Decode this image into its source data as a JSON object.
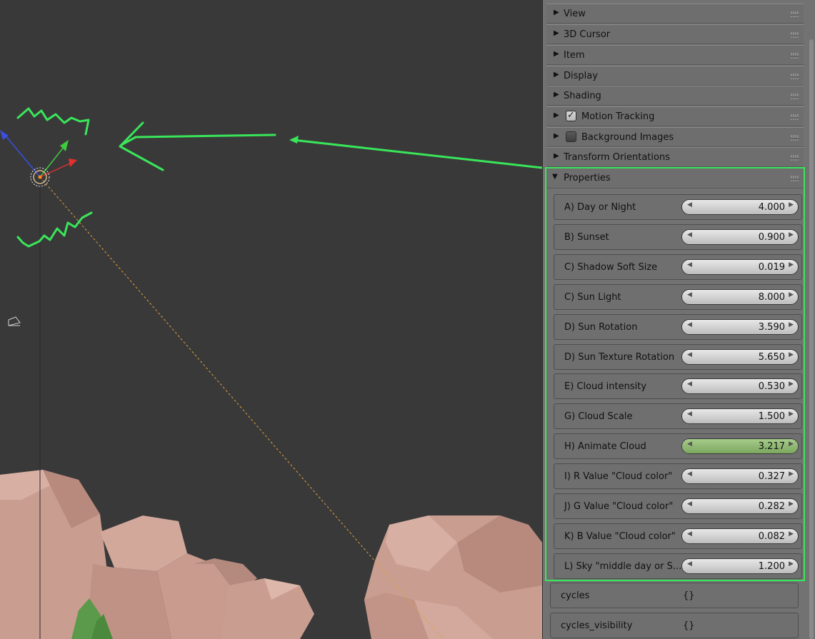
{
  "colors": {
    "accent_annotation": "#39e65a",
    "viewport_bg": "#393939",
    "panel_bg": "#727272",
    "slider_active": "#8db46c"
  },
  "viewport": {
    "icons": [
      "transform-gizmo-icon",
      "sun-lamp-icon",
      "camera-icon"
    ]
  },
  "panel": {
    "sections": [
      {
        "label": "View",
        "icon": "triangle-right-icon"
      },
      {
        "label": "3D Cursor",
        "icon": "triangle-right-icon"
      },
      {
        "label": "Item",
        "icon": "triangle-right-icon"
      },
      {
        "label": "Display",
        "icon": "triangle-right-icon"
      },
      {
        "label": "Shading",
        "icon": "triangle-right-icon"
      },
      {
        "label": "Motion Tracking",
        "icon": "triangle-right-icon",
        "checkbox": true
      },
      {
        "label": "Background Images",
        "icon": "triangle-right-icon",
        "checkbox": false
      },
      {
        "label": "Transform Orientations",
        "icon": "triangle-right-icon"
      }
    ],
    "properties": {
      "label": "Properties",
      "icon": "triangle-down-icon",
      "rows": [
        {
          "label": "A) Day or Night",
          "value": "4.000"
        },
        {
          "label": "B) Sunset",
          "value": "0.900"
        },
        {
          "label": "C) Shadow Soft Size",
          "value": "0.019"
        },
        {
          "label": "C) Sun Light",
          "value": "8.000"
        },
        {
          "label": "D) Sun Rotation",
          "value": "3.590"
        },
        {
          "label": "D) Sun Texture Rotation",
          "value": "5.650"
        },
        {
          "label": "E) Cloud intensity",
          "value": "0.530"
        },
        {
          "label": "G) Cloud Scale",
          "value": "1.500"
        },
        {
          "label": "H) Animate Cloud",
          "value": "3.217",
          "active": true,
          "fill_fraction": 1.0
        },
        {
          "label": "I) R Value \"Cloud color\"",
          "value": "0.327"
        },
        {
          "label": "J) G Value \"Cloud color\"",
          "value": "0.282"
        },
        {
          "label": "K) B Value \"Cloud color\"",
          "value": "0.082"
        },
        {
          "label": "L) Sky \"middle day or S...",
          "value": "1.200"
        }
      ]
    },
    "extra_rows": [
      {
        "label": "cycles",
        "value": "{}"
      },
      {
        "label": "cycles_visibility",
        "value": "{}"
      }
    ]
  }
}
